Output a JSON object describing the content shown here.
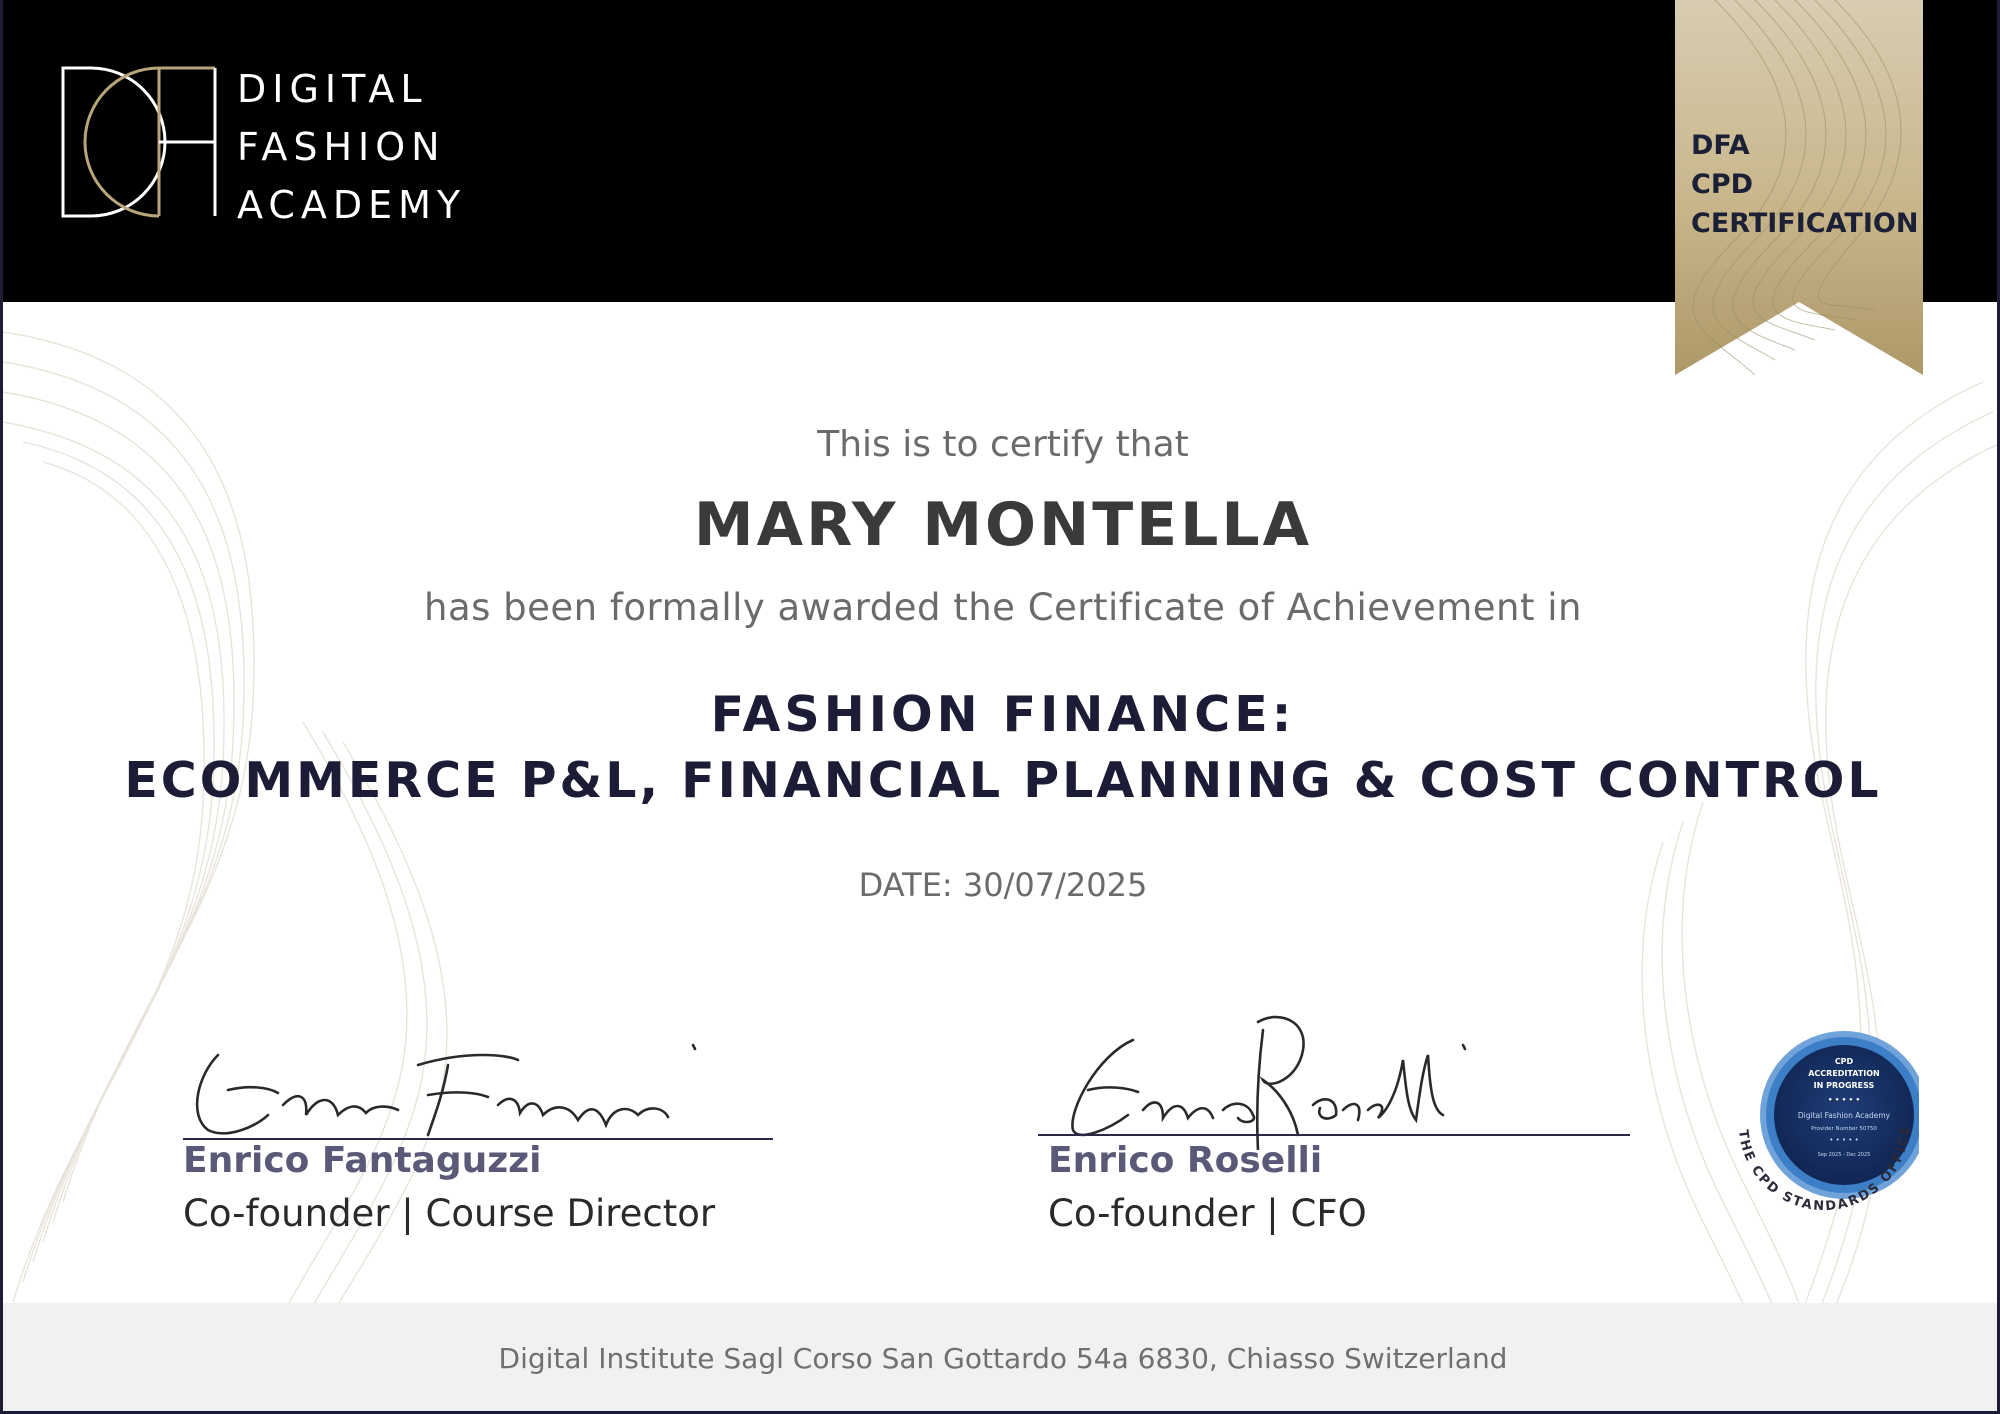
{
  "brand": {
    "line1": "DIGITAL",
    "line2": "FASHION",
    "line3": "ACADEMY"
  },
  "ribbon": {
    "line1": "DFA",
    "line2": "CPD",
    "line3": "CERTIFICATION"
  },
  "certificate": {
    "intro": "This is to certify that",
    "recipient": "MARY MONTELLA",
    "awarded_text": "has been formally awarded the Certificate of Achievement in",
    "course_line1": "FASHION FINANCE:",
    "course_line2": "ECOMMERCE P&L, FINANCIAL PLANNING & COST CONTROL",
    "date": "DATE: 30/07/2025"
  },
  "signatories": [
    {
      "name": "Enrico Fantaguzzi",
      "role": "Co-founder | Course Director"
    },
    {
      "name": "Enrico Roselli",
      "role": "Co-founder | CFO"
    }
  ],
  "seal": {
    "line1": "CPD",
    "line2": "ACCREDITATION",
    "line3": "IN PROGRESS",
    "provider": "Digital Fashion Academy",
    "provider_number": "Provider Number 50750",
    "period": "Sep 2025 - Dec 2025",
    "ring_text": "THE CPD STANDARDS OFFICE"
  },
  "footer": {
    "address": "Digital Institute Sagl  Corso San Gottardo 54a 6830, Chiasso Switzerland"
  },
  "colors": {
    "header_bg": "#000000",
    "gold": "#b8a57a",
    "navy": "#1c1c36",
    "seal_blue": "#2f6db5"
  }
}
